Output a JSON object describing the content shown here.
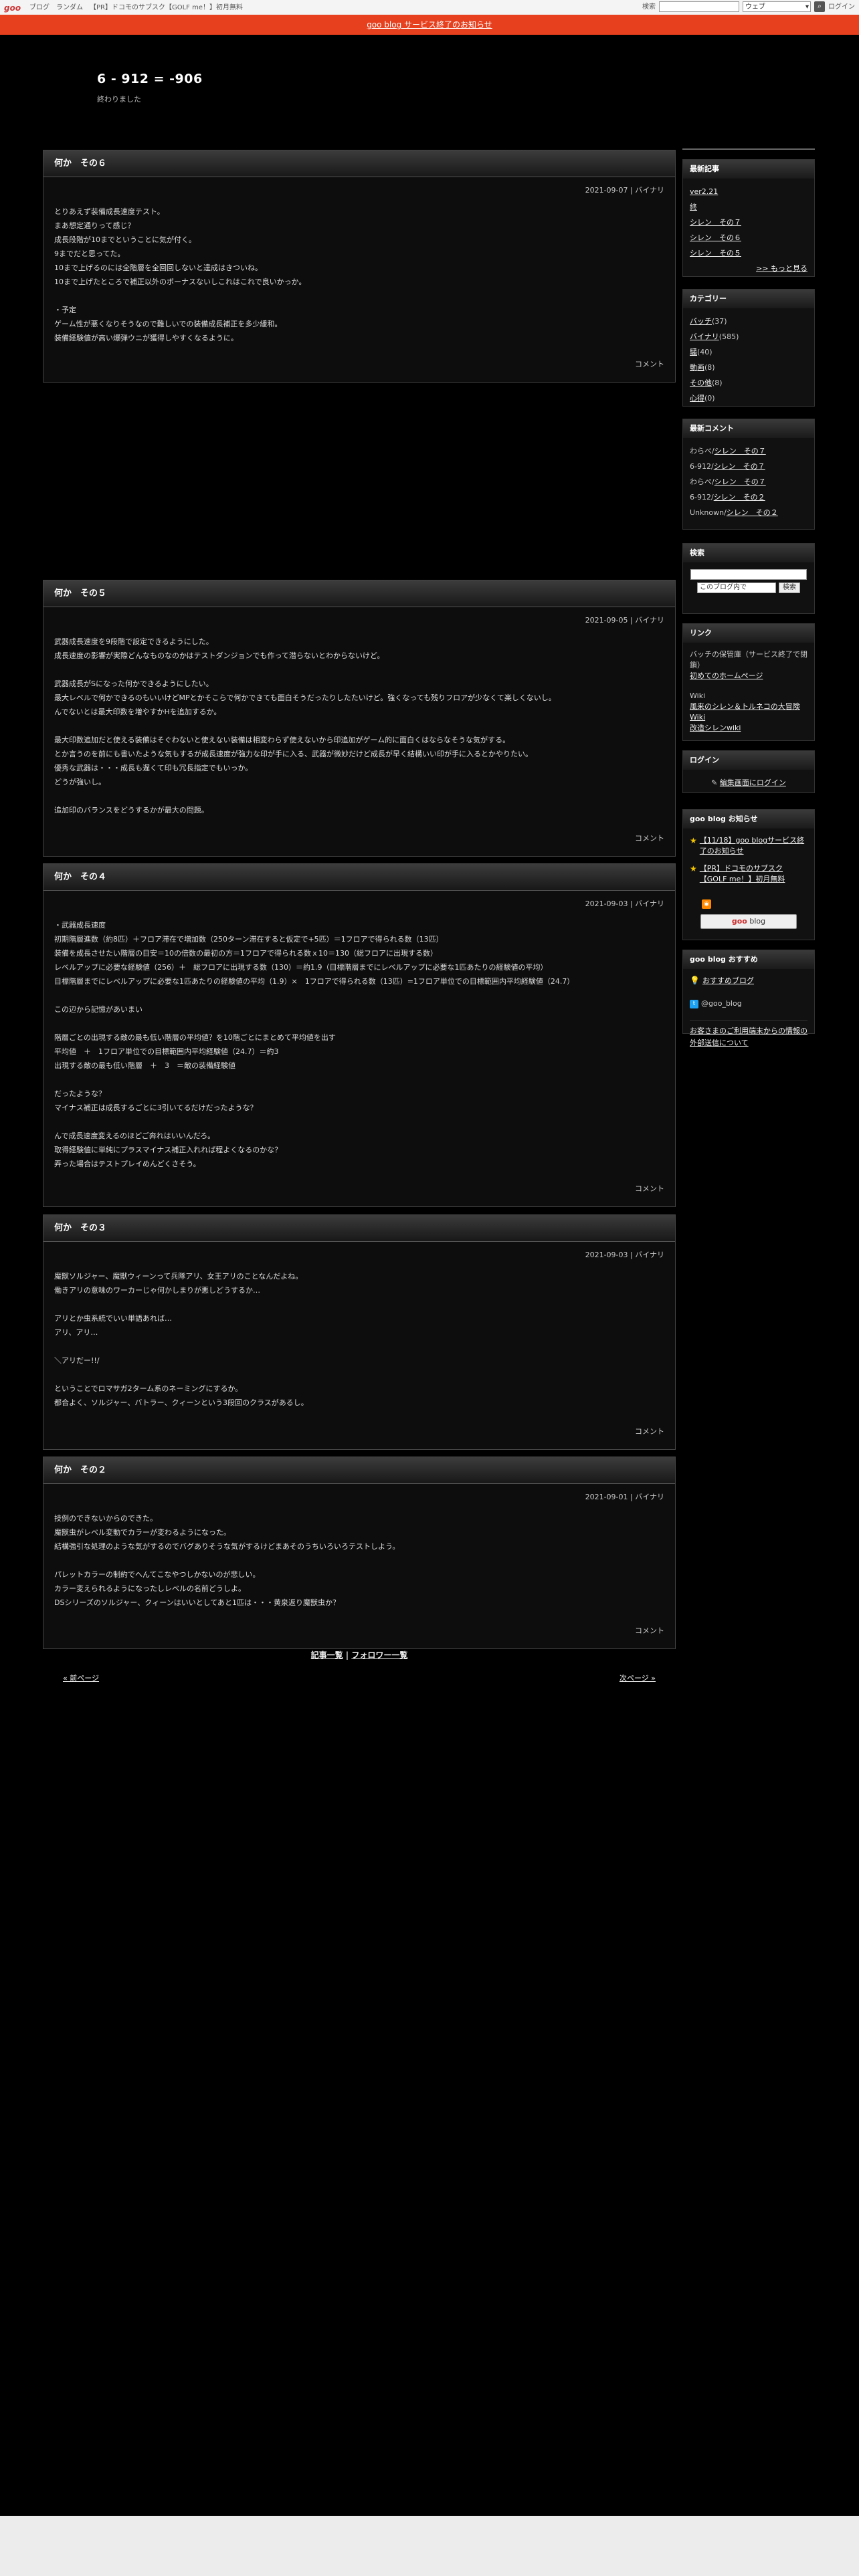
{
  "topbar": {
    "logo": "goo",
    "links": [
      "ブログ",
      "ランダム",
      "【PR】ドコモのサブスク【GOLF me！】初月無料"
    ],
    "search_label": "検索",
    "search_select": "ウェブ",
    "login": "ログイン"
  },
  "notice": {
    "text": "goo blog サービス終了のお知らせ"
  },
  "blog": {
    "title": "6 - 912 = -906",
    "description": "終わりました"
  },
  "entries": [
    {
      "title": "何か　その６",
      "date": "2021-09-07",
      "category": "バイナリ",
      "body": "とりあえず装備成長速度テスト。\nまあ想定通りって感じ？\n成長段階が10までということに気が付く。\n9までだと思ってた。\n10まで上げるのには全階層を全回回しないと達成はきついね。\n10まで上げたところで補正以外のボーナスないしこれはこれで良いかっか。\n\n・予定\nゲーム性が悪くなりそうなので難しいでの装備成長補正を多少緩和。\n装備経験値が高い爆弾ウニが獲得しやすくなるように。",
      "comment": "コメント"
    },
    {
      "title": "何か　その５",
      "date": "2021-09-05",
      "category": "バイナリ",
      "body": "武器成長速度を9段階で設定できるようにした。\n成長速度の影響が実際どんなものなのかはテストダンジョンでも作って潜らないとわからないけど。\n\n武器成長がSになった何かできるようにしたい。\n最大レベルで何かできるのもいいけどMPとかそこらで何かできても面白そうだったりしたたいけど。強くなっても残りフロアが少なくて楽しくないし。\nんでないとは最大印数を増やすかHを追加するか。\n\n最大印数追加だと使える装備はそぐわないと使えない装備は相変わらず使えないから印追加がゲーム的に面白くはならなそうな気がする。\nとか言うのを前にも書いたような気もするが成長速度が強力な印が手に入る、武器が微妙だけど成長が早く結構いい印が手に入るとかやりたい。\n優秀な武器は・・・成長も遅くて印も冗長指定でもいっか。\nどうが強いし。\n\n追加印のバランスをどうするかが最大の問題。",
      "comment": "コメント"
    },
    {
      "title": "何か　その４",
      "date": "2021-09-03",
      "category": "バイナリ",
      "body": "・武器成長速度\n初期階層進数（約8匹）＋フロア滞在で増加数（250ターン滞在すると仮定で+5匹）＝1フロアで得られる数（13匹）\n装備を成長させたい階層の目安＝10の倍数の最初の方＝1フロアで得られる数ｘ10＝130（総フロアに出現する数）\nレベルアップに必要な経験値（256）＋　総フロアに出現する数（130）＝約1.9（目標階層までにレベルアップに必要な1匹あたりの経験値の平均）\n目標階層までにレベルアップに必要な1匹あたりの経験値の平均（1.9）×　1フロアで得られる数（13匹）=1フロア単位での目標範囲内平均経験値（24.7）\n\nこの辺から記憶があいまい\n\n階層ごとの出現する敵の最も低い階層の平均値？を10階ごとにまとめて平均値を出す\n平均値　＋　1フロア単位での目標範囲内平均経験値（24.7）＝約3\n出現する敵の最も低い階層　＋　3　＝敵の装備経験値\n\nだったような？\nマイナス補正は成長するごとに3引いてるだけだったような？\n\nんで成長速度変えるのほどご奔れはいいんだろ。\n取得経験値に単純にプラスマイナス補正入れれば程よくなるのかな？\n弄った場合はテストプレイめんどくさそう。",
      "comment": "コメント"
    },
    {
      "title": "何か　その３",
      "date": "2021-09-03",
      "category": "バイナリ",
      "body": "魔獣ソルジャー、魔獣ウィーンって兵隊アリ、女王アリのことなんだよね。\n働きアリの意味のワーカーじゃ何かしまりが悪しどうするか…\n\nアリとか虫系統でいい単語あれば…\nアリ、アリ…\n\n＼アリだー!!/\n\nということでロマサガ2ターム系のネーミングにするか。\n都合よく、ソルジャー、バトラー、クィーンという3段回のクラスがあるし。",
      "comment": "コメント"
    },
    {
      "title": "何か　その２",
      "date": "2021-09-01",
      "category": "バイナリ",
      "body": "技例のできないからのできた。\n魔獣虫がレベル変動でカラーが変わるようになった。\n結構強引な処理のような気がするのでバグありそうな気がするけどまあそのうちいろいろテストしよう。\n\nパレットカラーの制約でへんてこなやつしかないのが悲しい。\nカラー変えられるようになったしレベルの名前どうしよ。\nDSシリーズのソルジャー、クィーンはいいとしてあと1匹は・・・黄泉返り魔獣虫か？",
      "comment": "コメント"
    }
  ],
  "entry_nav": {
    "list": "記事一覧",
    "separator": "|",
    "followers": "フォロワー一覧"
  },
  "page_nav": {
    "prev": "« 前ページ",
    "next": "次ページ »"
  },
  "sidebar": {
    "recent": {
      "title": "最新記事",
      "items": [
        "ver2.21",
        "終",
        "シレン　その７",
        "シレン　その６",
        "シレン　その５"
      ],
      "more": ">> もっと見る"
    },
    "categories": {
      "title": "カテゴリー",
      "items": [
        {
          "name": "バッチ",
          "count": "(37)"
        },
        {
          "name": "バイナリ",
          "count": "(585)"
        },
        {
          "name": "騒",
          "count": "(40)"
        },
        {
          "name": "動画",
          "count": "(8)"
        },
        {
          "name": "その他",
          "count": "(8)"
        },
        {
          "name": "心得",
          "count": "(0)"
        }
      ]
    },
    "comments": {
      "title": "最新コメント",
      "items": [
        {
          "author": "わらべ",
          "sep": "/",
          "post": "シレン　その７"
        },
        {
          "author": "6-912",
          "sep": "/",
          "post": "シレン　その７"
        },
        {
          "author": "わらべ",
          "sep": "/",
          "post": "シレン　その７"
        },
        {
          "author": "6-912",
          "sep": "/",
          "post": "シレン　その２"
        },
        {
          "author": "Unknown",
          "sep": "/",
          "post": "シレン　その２"
        }
      ]
    },
    "search": {
      "title": "検索",
      "select": "このブログ内で",
      "button": "検索"
    },
    "links": {
      "title": "リンク",
      "heading": "バッチの保管庫（サービス終了で閉鎖）",
      "item1": "初めてのホームページ",
      "heading2": "Wiki",
      "item2": "風来のシレン＆トルネコの大冒険 Wiki",
      "item3": "改造シレンwiki"
    },
    "login": {
      "title": "ログイン",
      "link": "編集画面にログイン"
    },
    "goonews": {
      "title": "goo blog お知らせ",
      "items": [
        "【11/18】goo blogサービス終了のお知らせ",
        "【PR】ドコモのサブスク【GOLF me！】初月無料"
      ],
      "button_logo": "goo",
      "button_text": "blog"
    },
    "recommend": {
      "title": "goo blog おすすめ",
      "item": "おすすめブログ",
      "twitter": "@goo_blog"
    },
    "external": {
      "text": "お客さまのご利用端末からの情報の外部送信について"
    }
  }
}
